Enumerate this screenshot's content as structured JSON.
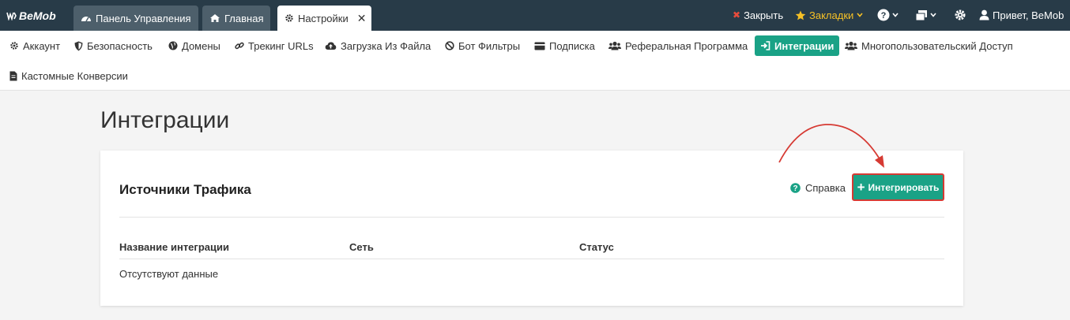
{
  "topbar": {
    "logo": "BeMob",
    "tabs": [
      {
        "label": "Панель Управления",
        "icon": "dashboard-icon"
      },
      {
        "label": "Главная",
        "icon": "home-icon"
      },
      {
        "label": "Настройки",
        "icon": "gear-icon",
        "close": "✕"
      }
    ],
    "close_label": "Закрыть",
    "bookmarks_label": "Закладки",
    "greeting": "Привет, BeMob"
  },
  "settings_nav": [
    {
      "label": "Аккаунт",
      "icon": "gear-icon"
    },
    {
      "label": "Безопасность",
      "icon": "shield-icon"
    },
    {
      "label": "Домены",
      "icon": "globe-icon"
    },
    {
      "label": "Трекинг URLs",
      "icon": "link-icon"
    },
    {
      "label": "Загрузка Из Файла",
      "icon": "cloud-upload-icon"
    },
    {
      "label": "Бот Фильтры",
      "icon": "ban-icon"
    },
    {
      "label": "Подписка",
      "icon": "credit-card-icon"
    },
    {
      "label": "Реферальная Программа",
      "icon": "users-icon"
    },
    {
      "label": "Интеграции",
      "icon": "sign-in-icon",
      "active": true
    },
    {
      "label": "Многопользовательский Доступ",
      "icon": "users-icon"
    },
    {
      "label": "Кастомные Конверсии",
      "icon": "file-icon"
    }
  ],
  "page": {
    "title": "Интеграции",
    "section_title": "Источники Трафика",
    "help_label": "Справка",
    "integrate_button": "Интегрировать",
    "columns": [
      "Название интеграции",
      "Сеть",
      "Статус"
    ],
    "empty_text": "Отсутствуют данные"
  },
  "colors": {
    "topbar_bg": "#283b48",
    "accent": "#1aa286",
    "highlight": "#d63a33",
    "bookmark": "#f5c026",
    "close_x": "#e74c3c"
  }
}
